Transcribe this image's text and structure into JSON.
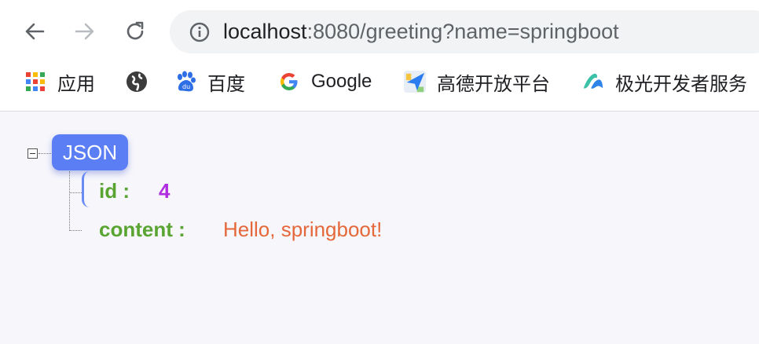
{
  "browser": {
    "url_host": "localhost",
    "url_rest": ":8080/greeting?name=springboot",
    "bookmarks": [
      {
        "label": "应用",
        "icon": "apps-grid-icon"
      },
      {
        "label": "",
        "icon": "globe-icon"
      },
      {
        "label": "百度",
        "icon": "baidu-paw-icon"
      },
      {
        "label": "Google",
        "icon": "google-g-icon"
      },
      {
        "label": "高德开放平台",
        "icon": "amap-icon"
      },
      {
        "label": "极光开发者服务",
        "icon": "jiguang-icon"
      }
    ]
  },
  "json_view": {
    "root_label": "JSON",
    "entries": [
      {
        "key": "id :",
        "value": "4"
      },
      {
        "key": "content :",
        "value": "Hello, springboot!"
      }
    ]
  },
  "colors": {
    "badge": "#5b7ef5",
    "key": "#5aa532",
    "number": "#b02ce0",
    "string": "#e4683a"
  }
}
